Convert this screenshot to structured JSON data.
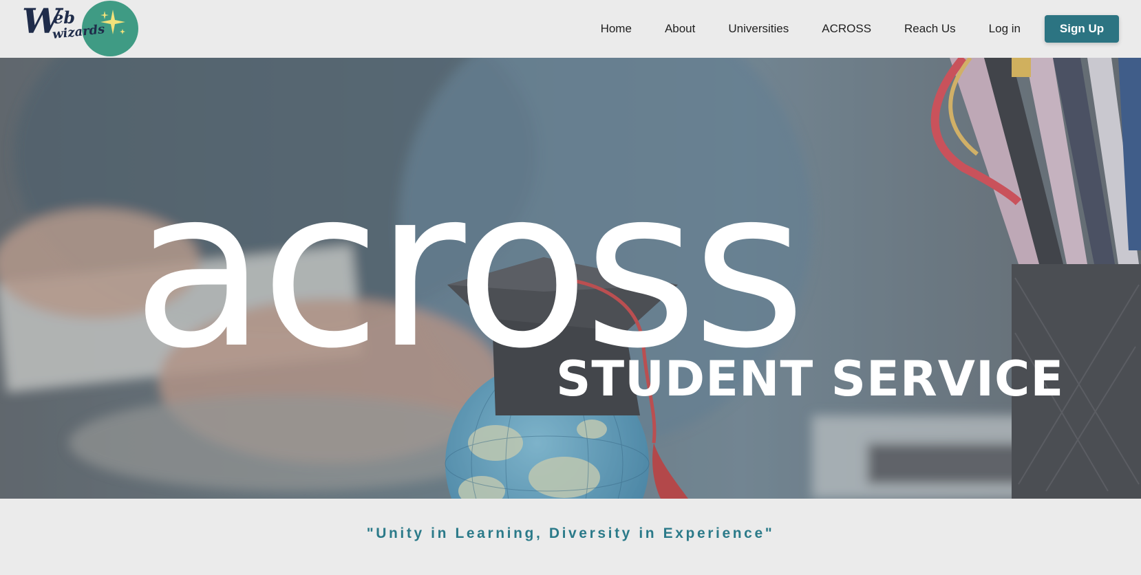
{
  "logo": {
    "text_primary": "Web",
    "text_secondary": "wizards",
    "icon": "sparkle-icon",
    "circle_color": "#3f9b84",
    "text_color": "#1f2c4a"
  },
  "nav": {
    "items": [
      {
        "label": "Home"
      },
      {
        "label": "About"
      },
      {
        "label": "Universities"
      },
      {
        "label": "ACROSS"
      },
      {
        "label": "Reach Us"
      },
      {
        "label": "Log in"
      }
    ],
    "signup_label": "Sign Up",
    "signup_color": "#2c7482"
  },
  "hero": {
    "title": "across",
    "subtitle": "STUDENT SERVICE"
  },
  "tagline": {
    "text": "\"Unity in Learning, Diversity in Experience\"",
    "color": "#2b7a89"
  },
  "colors": {
    "page_background": "#ebebeb",
    "hero_overlay": "#7b8187"
  }
}
